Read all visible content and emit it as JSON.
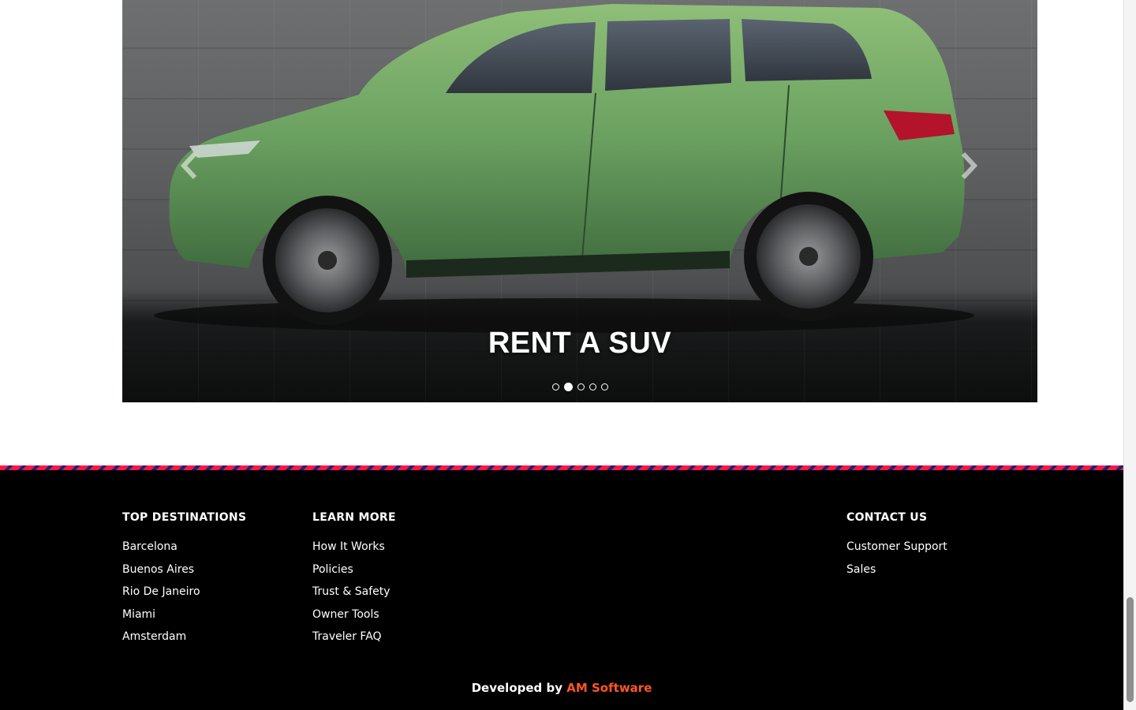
{
  "carousel": {
    "caption": "RENT A SUV",
    "slides": [
      "slide 1",
      "slide 2",
      "slide 3",
      "slide 4",
      "slide 5"
    ],
    "active_index": 1,
    "car_color": "#6aa060"
  },
  "footer": {
    "columns": [
      {
        "heading": "TOP DESTINATIONS",
        "links": [
          "Barcelona",
          "Buenos Aires",
          "Rio De Janeiro",
          "Miami",
          "Amsterdam"
        ]
      },
      {
        "heading": "LEARN MORE",
        "links": [
          "How It Works",
          "Policies",
          "Trust & Safety",
          "Owner Tools",
          "Traveler FAQ"
        ]
      },
      {
        "heading": "CONTACT US",
        "links": [
          "Customer Support",
          "Sales"
        ]
      }
    ],
    "credit_prefix": "Developed by",
    "credit_company": "AM Software",
    "accent_color": "#ff5722",
    "stripe_colors": [
      "#ff1744",
      "#1a237e"
    ]
  }
}
